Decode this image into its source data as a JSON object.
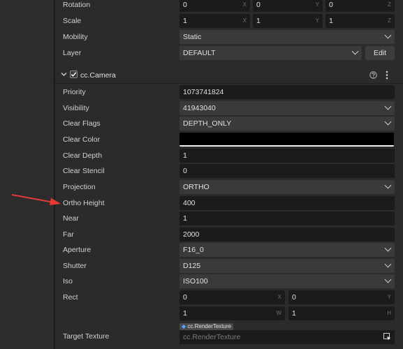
{
  "transform": {
    "rotation": {
      "label": "Rotation",
      "x": "0",
      "y": "0",
      "z": "0"
    },
    "scale": {
      "label": "Scale",
      "x": "1",
      "y": "1",
      "z": "1"
    },
    "mobility": {
      "label": "Mobility",
      "value": "Static"
    },
    "layer": {
      "label": "Layer",
      "value": "DEFAULT",
      "edit_label": "Edit"
    }
  },
  "axes": {
    "x": "X",
    "y": "Y",
    "z": "Z",
    "w": "W",
    "h": "H"
  },
  "camera": {
    "title": "cc.Camera",
    "priority": {
      "label": "Priority",
      "value": "1073741824"
    },
    "visibility": {
      "label": "Visibility",
      "value": "41943040"
    },
    "clear_flags": {
      "label": "Clear Flags",
      "value": "DEPTH_ONLY"
    },
    "clear_color": {
      "label": "Clear Color",
      "color": "#000000"
    },
    "clear_depth": {
      "label": "Clear Depth",
      "value": "1"
    },
    "clear_stencil": {
      "label": "Clear Stencil",
      "value": "0"
    },
    "projection": {
      "label": "Projection",
      "value": "ORTHO"
    },
    "ortho_height": {
      "label": "Ortho Height",
      "value": "400"
    },
    "near": {
      "label": "Near",
      "value": "1"
    },
    "far": {
      "label": "Far",
      "value": "2000"
    },
    "aperture": {
      "label": "Aperture",
      "value": "F16_0"
    },
    "shutter": {
      "label": "Shutter",
      "value": "D125"
    },
    "iso": {
      "label": "Iso",
      "value": "ISO100"
    },
    "rect": {
      "label": "Rect",
      "x": "0",
      "y": "0",
      "w": "1",
      "h": "1"
    },
    "target_texture": {
      "label": "Target Texture",
      "tag": "cc.RenderTexture",
      "placeholder": "cc.RenderTexture"
    }
  },
  "colors": {
    "annotation_arrow": "#e53935"
  }
}
